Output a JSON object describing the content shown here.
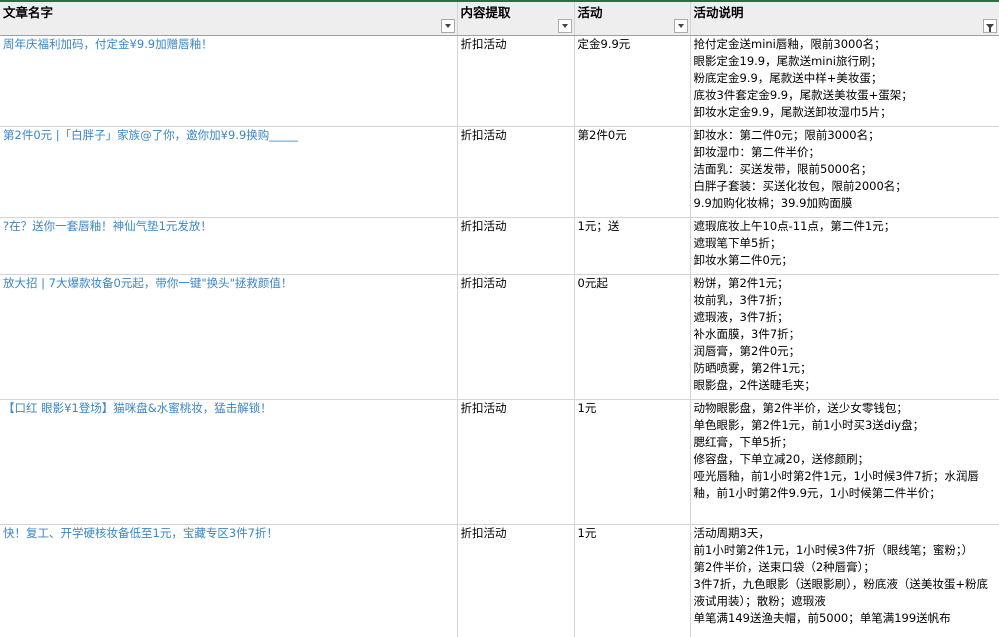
{
  "headers": {
    "col1": "文章名字",
    "col2": "内容提取",
    "col3": "活动",
    "col4": "活动说明"
  },
  "rows": [
    {
      "title": "周年庆福利加码，付定金¥9.9加赠唇釉！",
      "content": "折扣活动",
      "activity": "定金9.9元",
      "desc": [
        "抢付定金送mini唇釉，限前3000名；",
        "眼影定金19.9，尾款送mini旅行刷；",
        "粉底定金9.9，尾款送中样+美妆蛋；",
        "底妆3件套定金9.9，尾款送美妆蛋+蛋架；",
        "卸妆水定金9.9，尾款送卸妆湿巾5片；"
      ]
    },
    {
      "title": "第2件0元 |「白胖子」家族@了你，邀你加¥9.9换购_____",
      "content": "折扣活动",
      "activity": "第2件0元",
      "desc": [
        "卸妆水：第二件0元；限前3000名；",
        "卸妆湿巾：第二件半价；",
        "洁面乳：买送发带，限前5000名；",
        "白胖子套装：买送化妆包，限前2000名；",
        "9.9加购化妆棉；39.9加购面膜"
      ]
    },
    {
      "title": "?在？送你一套唇釉！神仙气垫1元发放！",
      "content": "折扣活动",
      "activity": "1元；送",
      "desc": [
        "遮瑕底妆上午10点-11点，第二件1元；",
        "遮瑕笔下单5折；",
        "卸妆水第二件0元；"
      ]
    },
    {
      "title": "放大招 | 7大爆款妆备0元起，带你一键\"换头\"拯救颜值！",
      "content": "折扣活动",
      "activity": "0元起",
      "desc": [
        "粉饼，第2件1元；",
        "妆前乳，3件7折；",
        "遮瑕液，3件7折；",
        "补水面膜，3件7折；",
        "润唇膏，第2件0元；",
        "防晒喷雾，第2件1元；",
        "眼影盘，2件送睫毛夹；"
      ]
    },
    {
      "title": "【口红 眼影¥1登场】猫咪盘&水蜜桃妆，猛击解锁！",
      "content": "折扣活动",
      "activity": "1元",
      "desc": [
        "动物眼影盘，第2件半价，送少女零钱包；",
        "单色眼影，第2件1元，前1小时买3送diy盘；",
        "腮红膏，下单5折；",
        "修容盘，下单立减20，送修颜刷；",
        "哑光唇釉，前1小时第2件1元，1小时候3件7折；水润唇釉，前1小时第2件9.9元，1小时候第二件半价；"
      ]
    },
    {
      "title": "快！复工、开学硬核妆备低至1元，宝藏专区3件7折！",
      "content": "折扣活动",
      "activity": "1元",
      "desc": [
        "活动周期3天，",
        "前1小时第2件1元，1小时候3件7折（眼线笔；蜜粉；）",
        "第2件半价，送束口袋（2种唇膏）；",
        "3件7折，九色眼影（送眼影刷），粉底液（送美妆蛋+粉底液试用装）；散粉；遮瑕液",
        "单笔满149送渔夫帽，前5000；单笔满199送帆布"
      ]
    }
  ]
}
